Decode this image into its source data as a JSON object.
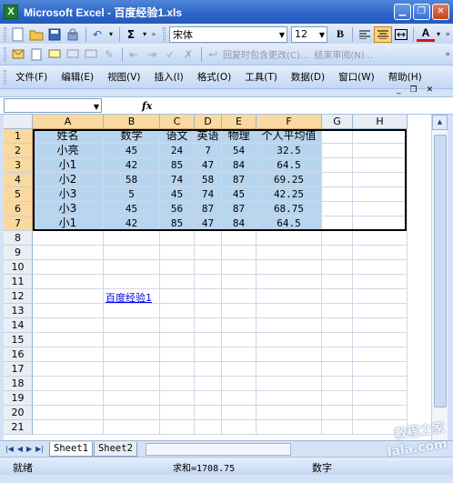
{
  "window": {
    "app_icon": "X",
    "title": "Microsoft Excel - 百度经验1.xls",
    "buttons": [
      "minimize-icon",
      "restore-icon",
      "close-icon"
    ]
  },
  "toolbar_standard": {
    "font_name": "宋体",
    "font_size": "12",
    "bold_label": "B",
    "font_color_label": "A"
  },
  "toolbar_review": {
    "reply_label": "回复时包含更改(C)...",
    "end_review_label": "结束审阅(N)..."
  },
  "menu": {
    "items": [
      "文件(F)",
      "编辑(E)",
      "视图(V)",
      "插入(I)",
      "格式(O)",
      "工具(T)",
      "数据(D)",
      "窗口(W)",
      "帮助(H)"
    ]
  },
  "formula_bar": {
    "name_box": "",
    "fx_label": "fx",
    "content": ""
  },
  "sheet": {
    "columns": [
      "A",
      "B",
      "C",
      "D",
      "E",
      "F",
      "G",
      "H"
    ],
    "rows": [
      "1",
      "2",
      "3",
      "4",
      "5",
      "6",
      "7",
      "8",
      "9",
      "10",
      "11",
      "12",
      "13",
      "14",
      "15",
      "16",
      "17",
      "18",
      "19",
      "20",
      "21"
    ],
    "data": [
      [
        "姓名",
        "数学",
        "语文",
        "英语",
        "物理",
        "个人平均值"
      ],
      [
        "小亮",
        "45",
        "24",
        "7",
        "54",
        "32.5"
      ],
      [
        "小1",
        "42",
        "85",
        "47",
        "84",
        "64.5"
      ],
      [
        "小2",
        "58",
        "74",
        "58",
        "87",
        "69.25"
      ],
      [
        "小3",
        "5",
        "45",
        "74",
        "45",
        "42.25"
      ],
      [
        "小3",
        "45",
        "56",
        "87",
        "87",
        "68.75"
      ],
      [
        "小1",
        "42",
        "85",
        "47",
        "84",
        "64.5"
      ]
    ],
    "link_text": "百度经验1",
    "link_cell": "B12"
  },
  "tabs": [
    "Sheet1",
    "Sheet2"
  ],
  "status": {
    "ready": "就绪",
    "sum": "求和=1708.75",
    "mode": "数字"
  },
  "watermark": "教程之家\nlala.com"
}
